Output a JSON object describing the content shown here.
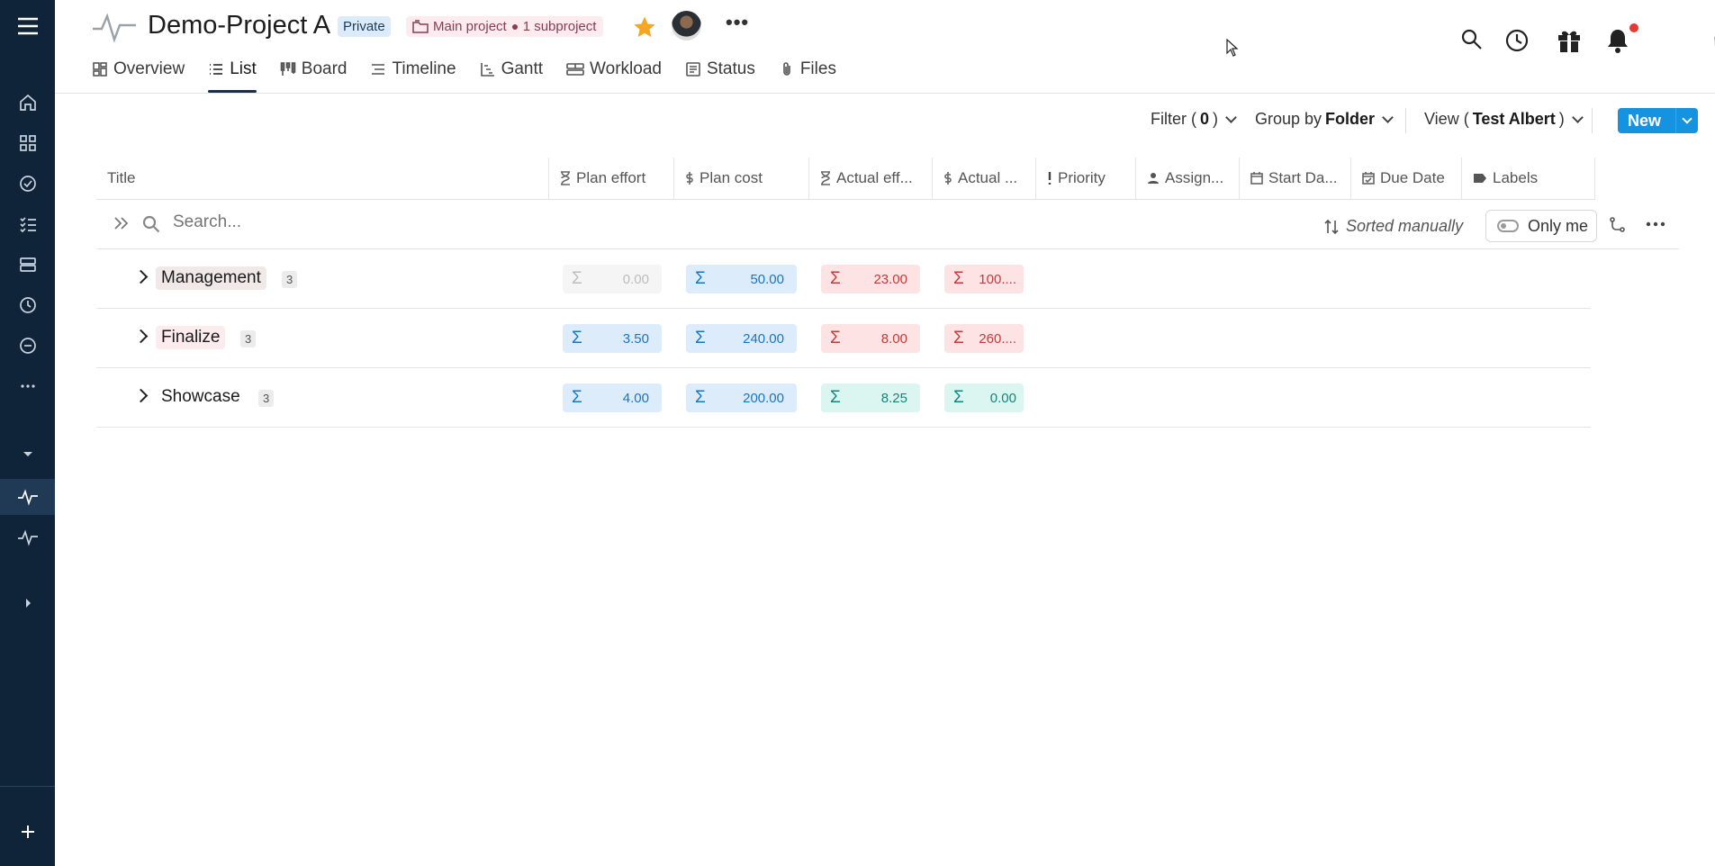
{
  "project": {
    "title": "Demo-Project A",
    "visibility": "Private",
    "hierarchy_main": "Main project",
    "hierarchy_sub": "1 subproject",
    "favorite": true,
    "more_label": "•••"
  },
  "tabs": [
    {
      "label": "Overview",
      "icon": "overview-icon",
      "active": false
    },
    {
      "label": "List",
      "icon": "list-icon",
      "active": true
    },
    {
      "label": "Board",
      "icon": "board-icon",
      "active": false
    },
    {
      "label": "Timeline",
      "icon": "timeline-icon",
      "active": false
    },
    {
      "label": "Gantt",
      "icon": "gantt-icon",
      "active": false
    },
    {
      "label": "Workload",
      "icon": "workload-icon",
      "active": false
    },
    {
      "label": "Status",
      "icon": "status-icon",
      "active": false
    },
    {
      "label": "Files",
      "icon": "paperclip-icon",
      "active": false
    }
  ],
  "toolbar": {
    "filter_prefix": "Filter (",
    "filter_count": "0",
    "filter_suffix": ")",
    "group_prefix": "Group by ",
    "group_value": "Folder",
    "view_prefix": "View (",
    "view_value": "Test Albert",
    "view_suffix": ")",
    "new_label": "New"
  },
  "columns": [
    {
      "label": "Title",
      "icon": ""
    },
    {
      "label": "Plan effort",
      "icon": "hourglass-icon"
    },
    {
      "label": "Plan cost",
      "icon": "dollar-icon"
    },
    {
      "label": "Actual eff...",
      "icon": "hourglass-icon"
    },
    {
      "label": "Actual ...",
      "icon": "dollar-icon"
    },
    {
      "label": "Priority",
      "icon": "exclamation-icon"
    },
    {
      "label": "Assign...",
      "icon": "person-icon"
    },
    {
      "label": "Start Da...",
      "icon": "calendar-icon"
    },
    {
      "label": "Due Date",
      "icon": "calendar-check-icon"
    },
    {
      "label": "Labels",
      "icon": "tag-icon"
    }
  ],
  "search": {
    "placeholder": "Search...",
    "sort_label": "Sorted manually",
    "only_me_label": "Only me"
  },
  "groups": [
    {
      "name": "Management",
      "count": "3",
      "name_bg": "#f1e9e7",
      "cells": [
        {
          "value": "0.00",
          "style": "gray"
        },
        {
          "value": "50.00",
          "style": "blue"
        },
        {
          "value": "23.00",
          "style": "red"
        },
        {
          "value": "100....",
          "style": "red"
        }
      ]
    },
    {
      "name": "Finalize",
      "count": "3",
      "name_bg": "#fcebef",
      "cells": [
        {
          "value": "3.50",
          "style": "blue"
        },
        {
          "value": "240.00",
          "style": "blue"
        },
        {
          "value": "8.00",
          "style": "red"
        },
        {
          "value": "260....",
          "style": "red"
        }
      ]
    },
    {
      "name": "Showcase",
      "count": "3",
      "name_bg": "transparent",
      "cells": [
        {
          "value": "4.00",
          "style": "blue"
        },
        {
          "value": "200.00",
          "style": "blue"
        },
        {
          "value": "8.25",
          "style": "teal"
        },
        {
          "value": "0.00",
          "style": "teal"
        }
      ]
    }
  ],
  "sigma": "Σ",
  "colors": {
    "rail": "#0f2438",
    "accent": "#1592e0",
    "star": "#f5a623",
    "notification": "#e53935"
  }
}
